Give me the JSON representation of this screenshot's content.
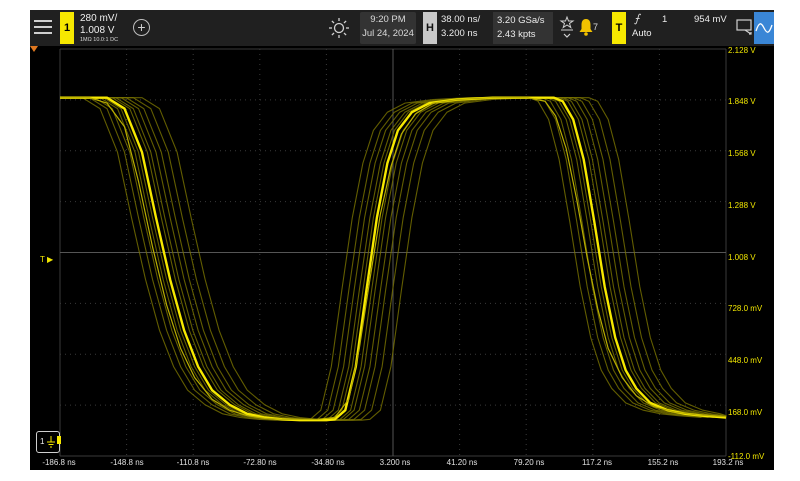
{
  "channel1": {
    "number": "1",
    "scale": "280 mV/",
    "offset": "1.008 V",
    "coupling": "1MΩ  10.0:1  DC"
  },
  "add_label": "+",
  "clock": {
    "time": "9:20 PM",
    "date": "Jul 24, 2024"
  },
  "horizontal": {
    "badge": "H",
    "scale": "38.00 ns/",
    "delay": "3.200 ns"
  },
  "acquisition": {
    "sample_rate": "3.20 GSa/s",
    "points": "2.43 kpts"
  },
  "notifications": {
    "count": "7"
  },
  "trigger": {
    "badge": "T",
    "edge_symbol": "⨍",
    "source": "1",
    "level": "954 mV",
    "mode": "Auto"
  },
  "y_axis": {
    "labels": [
      "2.128 V",
      "1.848 V",
      "1.568 V",
      "1.288 V",
      "1.008 V",
      "728.0 mV",
      "448.0 mV",
      "168.0 mV",
      "-112.0 mV"
    ]
  },
  "x_axis": {
    "labels": [
      "-186.8 ns",
      "-148.8 ns",
      "-110.8 ns",
      "-72.80 ns",
      "-34.80 ns",
      "3.200 ns",
      "41.20 ns",
      "79.20 ns",
      "117.2 ns",
      "155.2 ns",
      "193.2 ns"
    ]
  },
  "trigger_marker": "T ▶",
  "ground_marker": "1",
  "colors": {
    "channel1": "#f6e800",
    "persistence": "#7a7400",
    "grid": "#3a3a3a",
    "background": "#000000"
  },
  "chart_data": {
    "type": "line",
    "xlabel": "",
    "ylabel": "",
    "xlim": [
      -186.8,
      193.2
    ],
    "ylim": [
      -112.0,
      2128.0
    ],
    "x_unit": "ns",
    "y_unit": "mV",
    "grid": true,
    "series": [
      {
        "x": [
          -186.8,
          -160,
          -150,
          -140,
          -132,
          -124,
          -116,
          -108,
          -100,
          -90,
          -80,
          -70,
          -60,
          -50,
          -40,
          -34.8,
          -30,
          -24,
          -18,
          -12,
          -6,
          0,
          6,
          14,
          24,
          40,
          60,
          80,
          95,
          100,
          106,
          112,
          118,
          124,
          130,
          136,
          142,
          150,
          160,
          170,
          180,
          193.2
        ],
        "y": [
          1860,
          1860,
          1800,
          1560,
          1200,
          860,
          580,
          380,
          250,
          170,
          120,
          100,
          90,
          85,
          85,
          85,
          90,
          140,
          380,
          800,
          1200,
          1500,
          1680,
          1780,
          1830,
          1850,
          1860,
          1860,
          1860,
          1840,
          1740,
          1520,
          1180,
          820,
          540,
          360,
          260,
          180,
          140,
          120,
          110,
          100
        ]
      },
      {
        "x": [
          -186.8,
          -170,
          -160,
          -150,
          -142,
          -134,
          -126,
          -118,
          -110,
          -100,
          -90,
          -80,
          -70,
          -60,
          -50,
          -40,
          -30,
          -22,
          -16,
          -10,
          -4,
          2,
          8,
          16,
          26,
          40,
          60,
          80,
          90,
          96,
          102,
          108,
          114,
          120,
          126,
          134,
          142,
          152,
          164,
          176,
          193.2
        ],
        "y": [
          1860,
          1860,
          1830,
          1700,
          1400,
          1040,
          720,
          480,
          320,
          200,
          140,
          110,
          95,
          90,
          90,
          90,
          100,
          200,
          480,
          860,
          1220,
          1480,
          1660,
          1770,
          1830,
          1850,
          1860,
          1860,
          1840,
          1760,
          1580,
          1300,
          980,
          700,
          480,
          320,
          220,
          160,
          130,
          115,
          105
        ]
      }
    ]
  }
}
